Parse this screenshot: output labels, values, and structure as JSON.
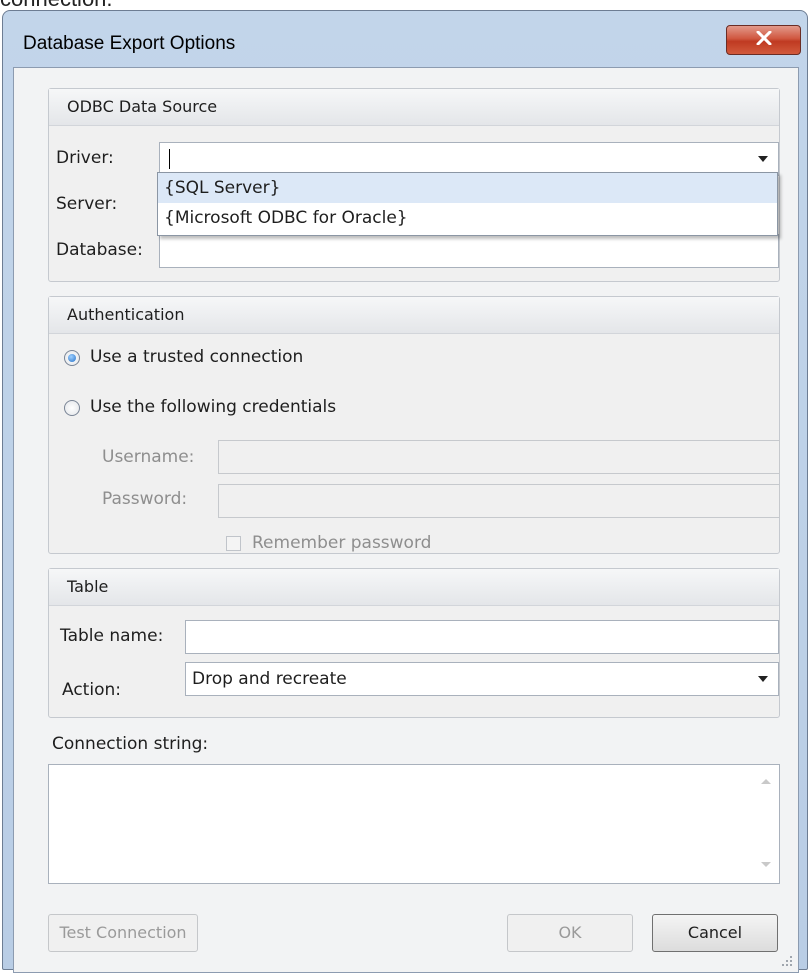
{
  "page_snippet": "connection.",
  "window": {
    "title": "Database Export Options",
    "close_glyph": "X"
  },
  "odbc": {
    "header": "ODBC Data Source",
    "driver_label": "Driver:",
    "driver_value": "",
    "server_label": "Server:",
    "database_label": "Database:",
    "driver_options": [
      "{SQL Server}",
      "{Microsoft ODBC for Oracle}"
    ]
  },
  "auth": {
    "header": "Authentication",
    "trusted_label": "Use a trusted connection",
    "credentials_label": "Use the following credentials",
    "username_label": "Username:",
    "password_label": "Password:",
    "remember_label": "Remember password"
  },
  "table": {
    "header": "Table",
    "name_label": "Table name:",
    "action_label": "Action:",
    "action_value": "Drop and recreate"
  },
  "connection": {
    "label": "Connection string:",
    "value": ""
  },
  "buttons": {
    "test": "Test Connection",
    "ok": "OK",
    "cancel": "Cancel"
  },
  "colors": {
    "close_button": "#c9412a",
    "selected_option": "#dce8f7",
    "radio_fill": "#2772c9"
  }
}
